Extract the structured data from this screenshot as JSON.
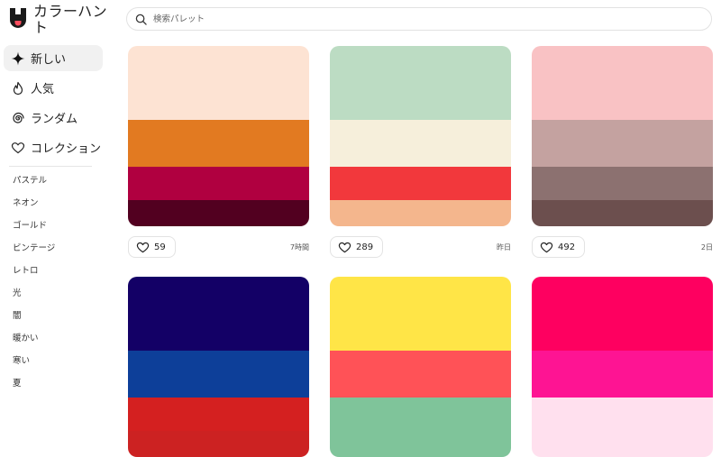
{
  "app": {
    "title": "カラーハント"
  },
  "search": {
    "placeholder": "検索パレット"
  },
  "nav": [
    {
      "label": "新しい",
      "icon": "sparkle-icon",
      "active": true
    },
    {
      "label": "人気",
      "icon": "flame-icon",
      "active": false
    },
    {
      "label": "ランダム",
      "icon": "spiral-icon",
      "active": false
    },
    {
      "label": "コレクション",
      "icon": "heart-icon",
      "active": false
    }
  ],
  "tags": [
    "パステル",
    "ネオン",
    "ゴールド",
    "ビンテージ",
    "レトロ",
    "光",
    "闇",
    "暖かい",
    "寒い",
    "夏"
  ],
  "palettes": [
    {
      "colors": [
        "#fde3d3",
        "#e27a21",
        "#b00040",
        "#520020"
      ],
      "likes": "59",
      "time": "7時間"
    },
    {
      "colors": [
        "#bcdcc3",
        "#f6efdb",
        "#f2383c",
        "#f4b68d"
      ],
      "likes": "289",
      "time": "昨日"
    },
    {
      "colors": [
        "#f9c2c4",
        "#c4a2a0",
        "#8c7170",
        "#6c4f4e"
      ],
      "likes": "492",
      "time": "2日"
    },
    {
      "colors": [
        "#130066",
        "#0d3f99",
        "#d42020",
        "#cc2222"
      ],
      "likes": "",
      "time": ""
    },
    {
      "colors": [
        "#ffe547",
        "#ff5257",
        "#7fc49a",
        "#7fc49a"
      ],
      "likes": "",
      "time": ""
    },
    {
      "colors": [
        "#fe0060",
        "#fe1493",
        "#ffe0ee",
        "#ffe0ee"
      ],
      "likes": "",
      "time": ""
    }
  ],
  "colors": {
    "active_nav_bg": "#f1f1f1",
    "border": "#e2e2e2"
  }
}
